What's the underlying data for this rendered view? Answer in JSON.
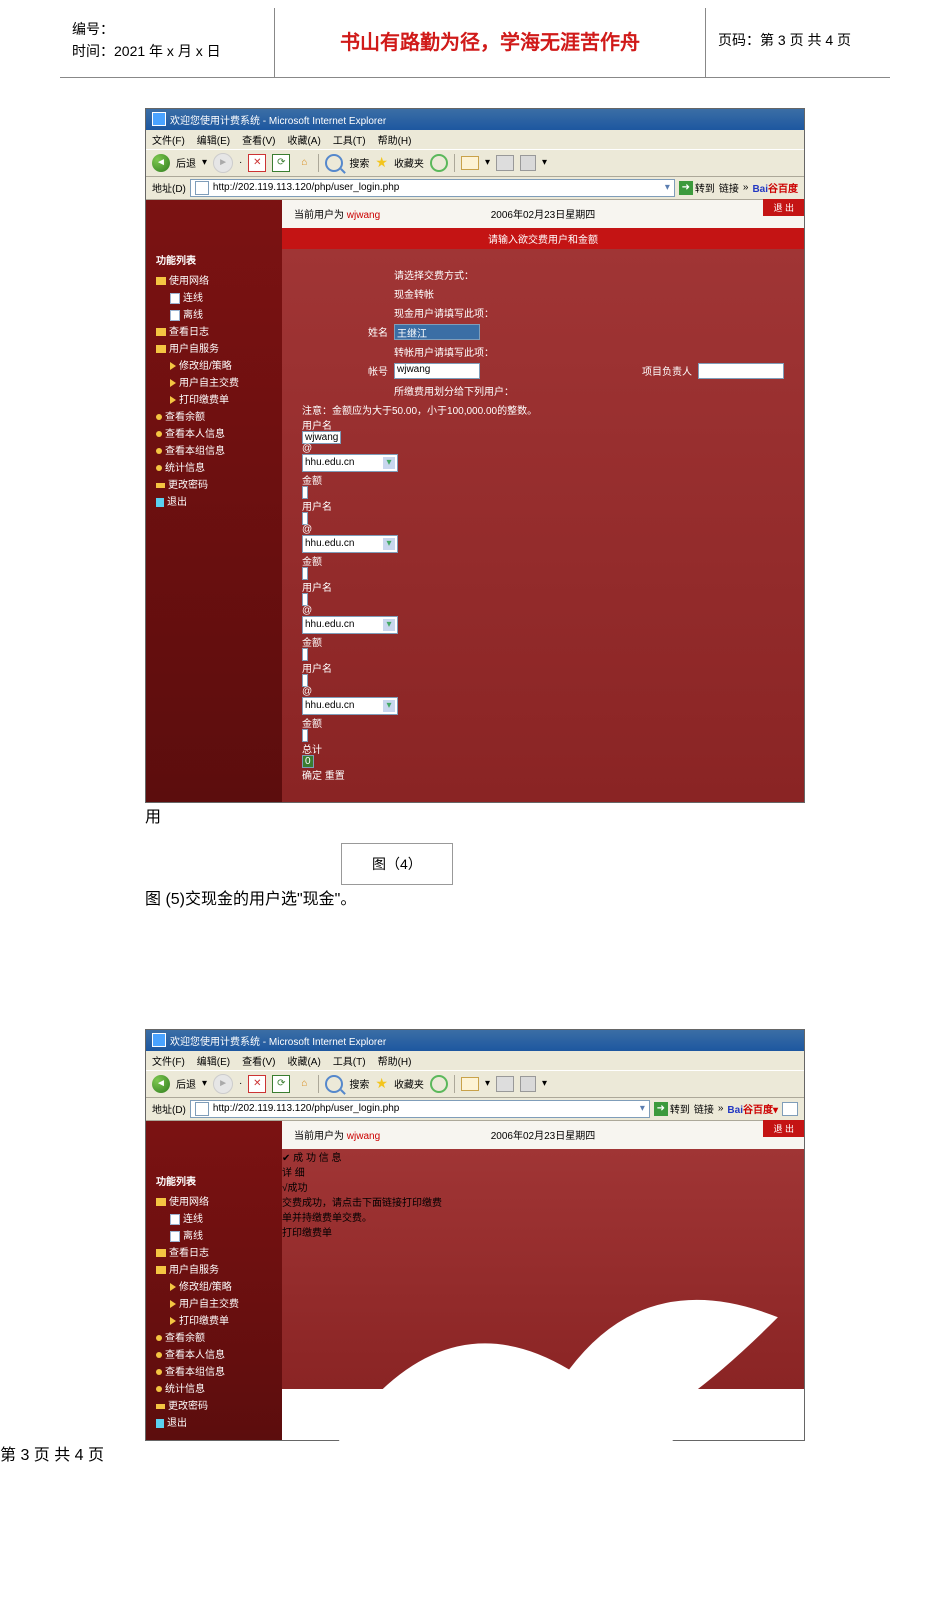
{
  "doc_header": {
    "number_label": "编号：",
    "time_label": "时间：2021 年 x 月 x 日",
    "motto": "书山有路勤为径，学海无涯苦作舟",
    "page_label": "页码：第 3 页  共 4 页"
  },
  "browser": {
    "title": "欢迎您使用计费系统 - Microsoft Internet Explorer",
    "menus": [
      "文件(F)",
      "编辑(E)",
      "查看(V)",
      "收藏(A)",
      "工具(T)",
      "帮助(H)"
    ],
    "back": "后退",
    "search": "搜索",
    "fav": "收藏夹",
    "addr_label": "地址(D)",
    "url": "http://202.119.113.120/php/user_login.php",
    "go": "转到",
    "links": "链接",
    "baidu": "Bai",
    "baidu2": "百度"
  },
  "app": {
    "current_user_prefix": "当前用户为 ",
    "current_user": "wjwang",
    "date": "2006年02月23日星期四",
    "logout": "退 出",
    "sidebar_title": "功能列表",
    "sidebar": [
      {
        "lvl": 1,
        "ico": "folder",
        "t": "使用网络"
      },
      {
        "lvl": 2,
        "ico": "page",
        "t": "连线"
      },
      {
        "lvl": 2,
        "ico": "page",
        "t": "离线"
      },
      {
        "lvl": 1,
        "ico": "folder",
        "t": "查看日志"
      },
      {
        "lvl": 1,
        "ico": "folder",
        "t": "用户自服务"
      },
      {
        "lvl": 2,
        "ico": "arrow",
        "t": "修改组/策略"
      },
      {
        "lvl": 2,
        "ico": "arrow",
        "t": "用户自主交费"
      },
      {
        "lvl": 2,
        "ico": "arrow",
        "t": "打印缴费单"
      },
      {
        "lvl": 1,
        "ico": "dot",
        "t": "查看余额"
      },
      {
        "lvl": 1,
        "ico": "dot",
        "t": "查看本人信息"
      },
      {
        "lvl": 1,
        "ico": "dot",
        "t": "查看本组信息"
      },
      {
        "lvl": 1,
        "ico": "dot",
        "t": "统计信息"
      },
      {
        "lvl": 1,
        "ico": "key",
        "t": "更改密码"
      },
      {
        "lvl": 1,
        "ico": "door",
        "t": "退出"
      }
    ]
  },
  "form": {
    "banner": "请输入欲交费用户和金额",
    "choose": "请选择交费方式：",
    "cash": "现金",
    "transfer": "转帐",
    "cash_hint": "现金用户请填写此项：",
    "name_label": "姓名",
    "name_value": "王继江",
    "transfer_hint": "转帐用户请填写此项：",
    "acct_label": "帐号",
    "acct_value": "wjwang",
    "owner_label": "项目负责人",
    "alloc_hint": "所缴费用划分给下列用户：",
    "note": "注意：金额应为大于50.00，小于100,000.00的整数。",
    "user_label": "用户名",
    "amount_label": "金额",
    "domain": "hhu.edu.cn",
    "row0_user": "wjwang",
    "total_label": "总计",
    "total_value": "0",
    "ok": "确定",
    "reset": "重置",
    "at": "@"
  },
  "fig4": "图（4）",
  "fig5": "图 (5)交现金的用户选\"现金\"。",
  "floating_char": "用",
  "success": {
    "title": "成 功 信 息",
    "detail_btn": "详 细",
    "line1": "√成功",
    "line2": "交费成功，请点击下面链接打印缴费",
    "line3": "单并持缴费单交费。",
    "print": "打印缴费单"
  },
  "footer": "第 3 页 共 4 页"
}
